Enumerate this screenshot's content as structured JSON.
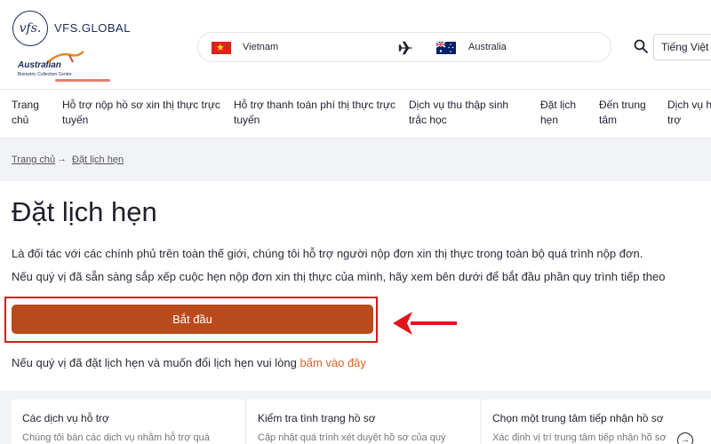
{
  "header": {
    "logo_mark": "vfs.",
    "logo_text": "VFS.GLOBAL",
    "sub_logo_title": "Australian",
    "sub_logo_sub": "Biometric Collection Centre",
    "origin_country": "Vietnam",
    "destination_country": "Australia",
    "language": "Tiếng Việt"
  },
  "nav": {
    "items": [
      {
        "line1": "Trang",
        "line2": "chủ"
      },
      {
        "line1": "Hỗ trợ nộp hồ sơ xin thị thực trực",
        "line2": "tuyến"
      },
      {
        "line1": "Hỗ trợ thanh toán phí thị thực trực",
        "line2": "tuyến"
      },
      {
        "line1": "Dịch vụ thu thập sinh",
        "line2": "trắc học"
      },
      {
        "line1": "Đặt lịch",
        "line2": "hẹn"
      },
      {
        "line1": "Đến trung",
        "line2": "tâm"
      },
      {
        "line1": "Dịch vụ hỗ",
        "line2": "trợ"
      }
    ]
  },
  "breadcrumb": {
    "home": "Trang chủ",
    "arrow": "→",
    "current": "Đặt lịch hẹn"
  },
  "main": {
    "title": "Đặt lịch hẹn",
    "intro_1": "Là đối tác với các chính phủ trên toàn thế giới, chúng tôi hỗ trợ người nộp đơn xin thị thực trong toàn bộ quá trình nộp đơn.",
    "intro_2": "Nếu quý vị đã sẵn sàng sắp xếp cuộc hẹn nộp đơn xin thị thực của mình, hãy xem bên dưới để bắt đầu phần quy trình tiếp theo",
    "start_label": "Bắt đầu",
    "resched_text": "Nếu quý vị đã đặt lịch hẹn và muốn đổi lịch hẹn vui lòng ",
    "resched_link": "bấm vào đây"
  },
  "cards": [
    {
      "title": "Các dịch vụ hỗ trợ",
      "desc": "Chúng tôi bán các dịch vụ nhằm hỗ trợ quá"
    },
    {
      "title": "Kiểm tra tình trạng hồ sơ",
      "desc": "Cập nhật quá trình xét duyệt hồ sơ của quý"
    },
    {
      "title": "Chọn một trung tâm tiếp nhận hồ sơ",
      "desc": "Xác định vị trí trung tâm tiếp nhận hồ sơ"
    }
  ],
  "card_arrow": "→",
  "colors": {
    "accent": "#b84a1c",
    "link": "#d9622b",
    "highlight": "#e0141b",
    "brand_navy": "#1c2a5a"
  }
}
